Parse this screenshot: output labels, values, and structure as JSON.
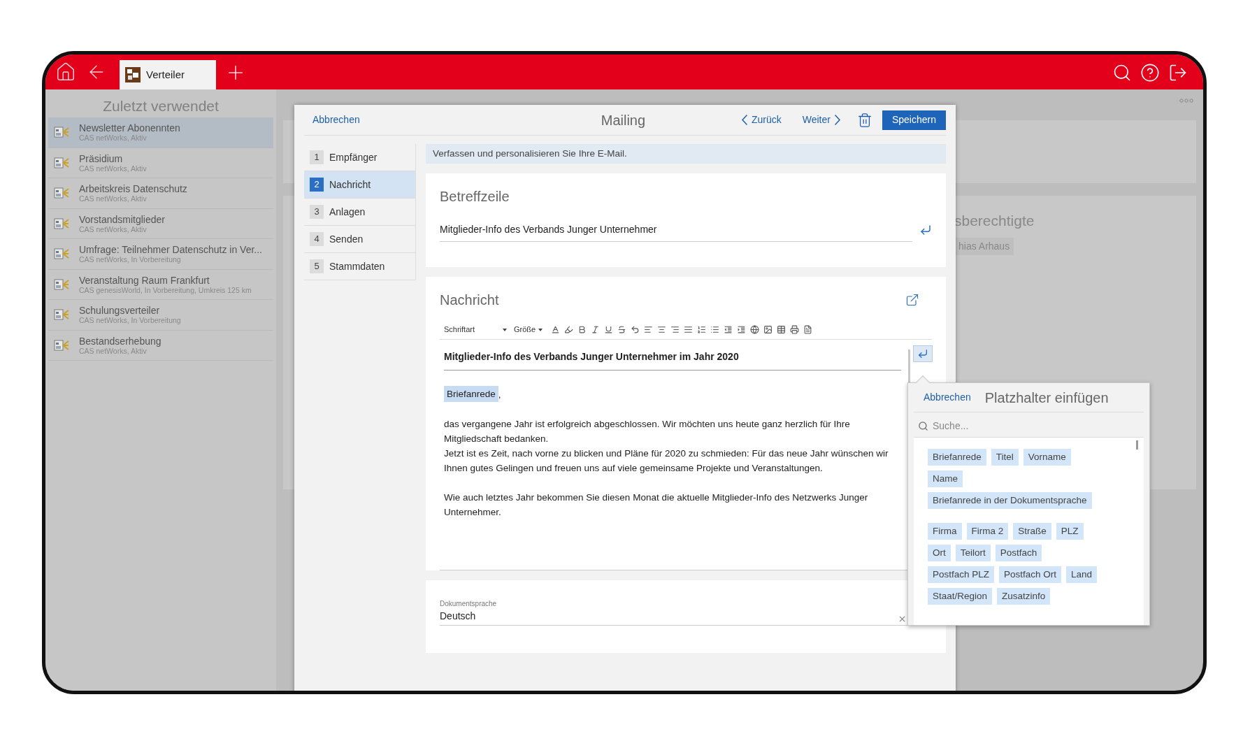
{
  "tab_bar": {
    "tabs": [
      {
        "label": "Verteiler",
        "selected": true
      }
    ]
  },
  "sidebar": {
    "title": "Zuletzt verwendet",
    "items": [
      {
        "name": "Newsletter Abonennten",
        "subtitle": "CAS netWorks, Aktiv",
        "selected": true
      },
      {
        "name": "Präsidium",
        "subtitle": "CAS netWorks, Aktiv",
        "selected": false
      },
      {
        "name": "Arbeitskreis Datenschutz",
        "subtitle": "CAS netWorks, Aktiv",
        "selected": false
      },
      {
        "name": "Vorstandsmitglieder",
        "subtitle": "CAS netWorks, Aktiv",
        "selected": false
      },
      {
        "name": "Umfrage: Teilnehmer Datenschutz in Ver...",
        "subtitle": "CAS netWorks, In Vorbereitung",
        "selected": false
      },
      {
        "name": "Veranstaltung Raum Frankfurt",
        "subtitle": "CAS genesisWorld, In Vorbereitung, Umkreis 125 km",
        "selected": false
      },
      {
        "name": "Schulungsverteiler",
        "subtitle": "CAS netWorks, In Vorbereitung",
        "selected": false
      },
      {
        "name": "Bestandserhebung",
        "subtitle": "CAS netWorks, Aktiv",
        "selected": false
      }
    ]
  },
  "background": {
    "heading": "sberechtigte",
    "chip": "hias Arhaus"
  },
  "dialog": {
    "cancel": "Abbrechen",
    "title": "Mailing",
    "back": "Zurück",
    "next": "Weiter",
    "save": "Speichern",
    "steps": [
      {
        "number": "1",
        "label": "Empfänger",
        "selected": false
      },
      {
        "number": "2",
        "label": "Nachricht",
        "selected": true
      },
      {
        "number": "3",
        "label": "Anlagen",
        "selected": false
      },
      {
        "number": "4",
        "label": "Senden",
        "selected": false
      },
      {
        "number": "5",
        "label": "Stammdaten",
        "selected": false
      }
    ],
    "hint": "Verfassen und personalisieren Sie Ihre E-Mail.",
    "subject": {
      "title": "Betreffzeile",
      "value": "Mitglieder-Info des Verbands Junger Unternehmer"
    },
    "message": {
      "title": "Nachricht",
      "font": "Schriftart",
      "size": "Größe",
      "heading": "Mitglieder-Info des Verbands Junger Unternehmer im Jahr 2020",
      "salutation": "Briefanrede",
      "salutation_suffix": ",",
      "paragraphs": [
        [
          "das vergangene Jahr ist erfolgreich abgeschlossen. Wir möchten uns heute ganz herzlich für Ihre Mitgliedschaft bedanken.",
          "Jetzt ist es Zeit, nach vorne zu blicken und Pläne für 2020 zu schmieden: Für das neue Jahr wünschen wir Ihnen gutes Gelingen und freuen uns auf viele gemeinsame Projekte und Veranstaltungen."
        ],
        [
          "Wie auch letztes Jahr bekommen Sie diesen Monat die aktuelle Mitglieder-Info des Netzwerks Junger Unternehmer."
        ]
      ]
    },
    "language": {
      "label": "Dokumentsprache",
      "value": "Deutsch"
    }
  },
  "placeholder_popup": {
    "cancel": "Abbrechen",
    "title": "Platzhalter einfügen",
    "search": {
      "placeholder": "Suche..."
    },
    "groups": [
      {
        "rows": [
          [
            "Briefanrede",
            "Titel",
            "Vorname"
          ],
          [
            "Name"
          ],
          [
            "Briefanrede in der Dokumentsprache"
          ]
        ]
      },
      {
        "rows": [
          [
            "Firma",
            "Firma 2",
            "Straße",
            "PLZ"
          ],
          [
            "Ort",
            "Teilort",
            "Postfach"
          ],
          [
            "Postfach PLZ",
            "Postfach Ort",
            "Land"
          ],
          [
            "Staat/Region",
            "Zusatzinfo"
          ]
        ]
      }
    ]
  }
}
